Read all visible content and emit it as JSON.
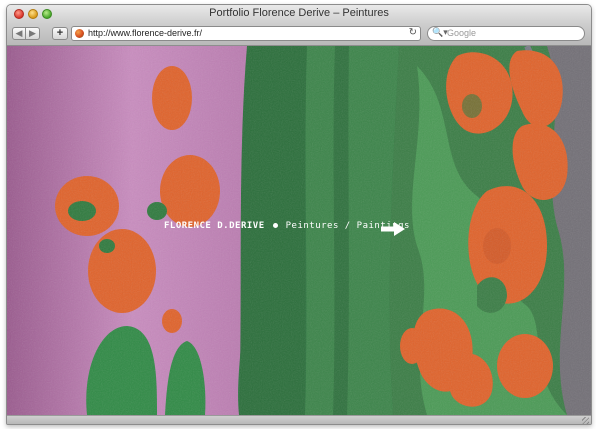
{
  "window": {
    "title": "Portfolio Florence Derive – Peintures"
  },
  "toolbar": {
    "back_glyph": "◀",
    "forward_glyph": "▶",
    "add_glyph": "+",
    "url": "http://www.florence-derive.fr/",
    "reload_glyph": "↻",
    "search_glyph": "🔍▾",
    "search_placeholder": "Google"
  },
  "page": {
    "artist_name": "FLORENCE D.DERIVE",
    "section": "Peintures / Paintings",
    "arrow_icon": "right-arrow-icon"
  },
  "colors": {
    "painting_pink": "#c07ab0",
    "painting_green": "#2f7a3e",
    "painting_orange": "#e0622a"
  }
}
